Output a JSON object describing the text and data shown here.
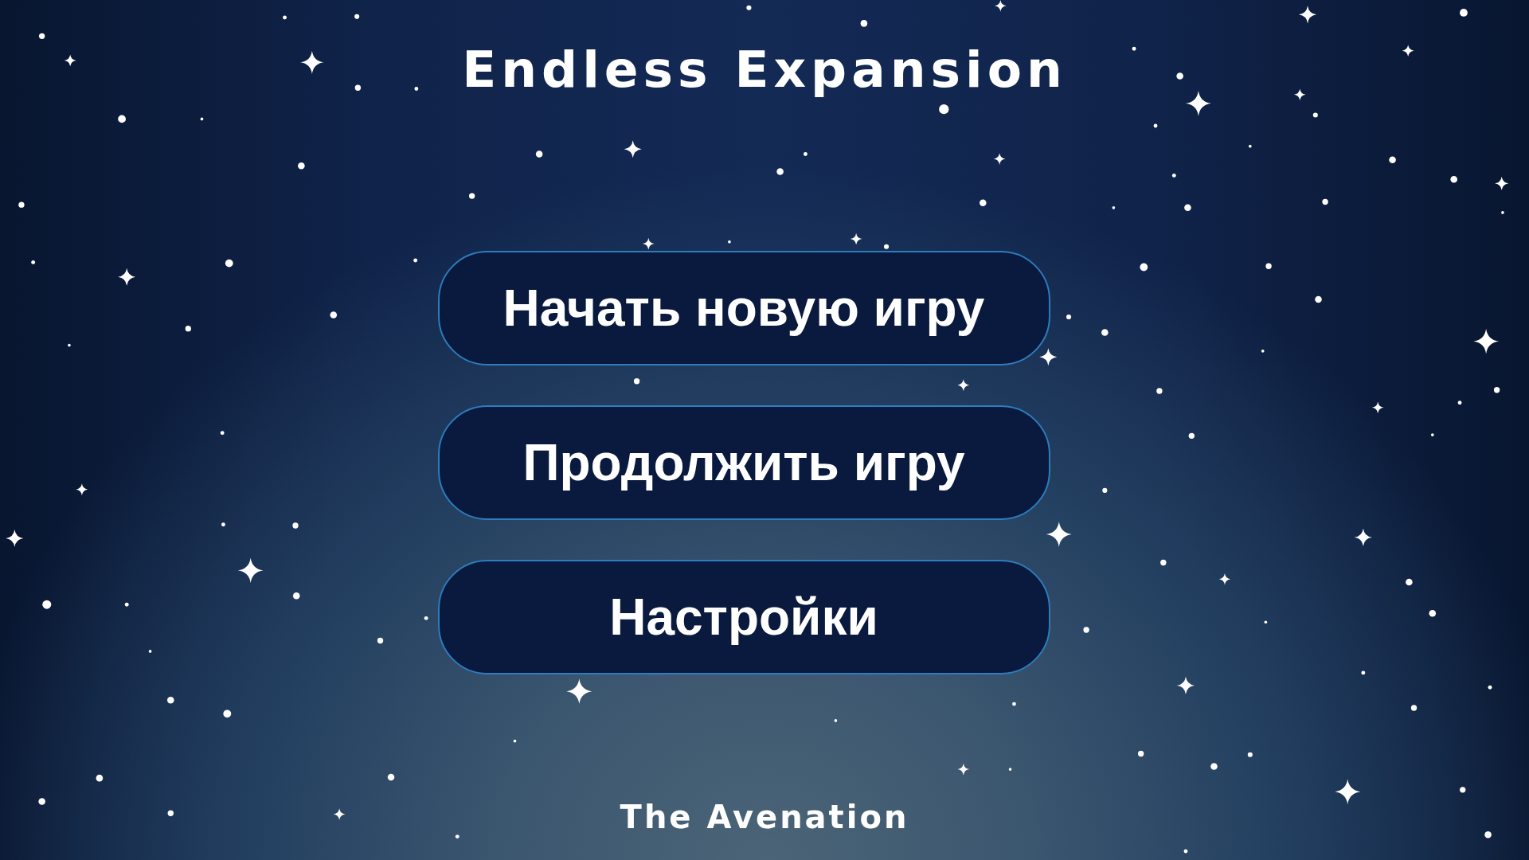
{
  "title": "Endless Expansion",
  "menu": [
    {
      "label": "Начать новую игру"
    },
    {
      "label": "Продолжить игру"
    },
    {
      "label": "Настройки"
    }
  ],
  "footer": "The Avenation"
}
